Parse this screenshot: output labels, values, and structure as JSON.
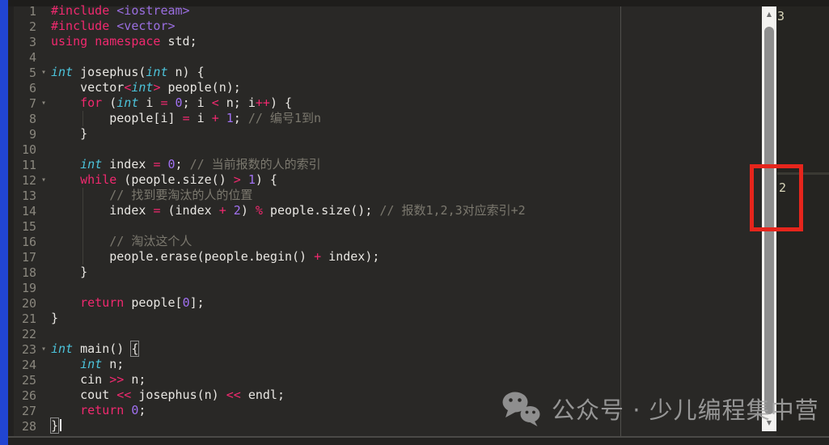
{
  "colors": {
    "bg": "#292826",
    "top-bar": "#1e1d1b",
    "blue": "#2145d2",
    "dark-strip": "#222120",
    "gutter-fg": "#8a877e",
    "kw": "#f1296f",
    "type": "#4cc3da",
    "num": "#a171f2",
    "inc": "#9a6ee0",
    "com": "#7b786e",
    "plain": "#e8e6e2",
    "guide": "#413f3a",
    "ruler": "#51504c",
    "track": "#f3f2f0",
    "thumb": "#8e8e8e",
    "arrow": "#6f6f6f",
    "red": "#e6251c",
    "ann": "#d9d6ba",
    "wm": "#a6a6a6",
    "bracket-box": "#8f8f8f",
    "caret": "#ececec",
    "bottom-line": "#4b4a47",
    "bottom-strip": "#232220",
    "right-panel": "#252421",
    "faint-line": "#3a3933"
  },
  "editor": {
    "language": "cpp",
    "fold_glyph": "▾",
    "lines": [
      {
        "num": "1",
        "fold": false,
        "tokens": [
          [
            "k",
            "#include"
          ],
          [
            "p",
            " "
          ],
          [
            "s",
            "<iostream>"
          ]
        ]
      },
      {
        "num": "2",
        "fold": false,
        "tokens": [
          [
            "k",
            "#include"
          ],
          [
            "p",
            " "
          ],
          [
            "s",
            "<vector>"
          ]
        ]
      },
      {
        "num": "3",
        "fold": false,
        "tokens": [
          [
            "k",
            "using"
          ],
          [
            "p",
            " "
          ],
          [
            "k",
            "namespace"
          ],
          [
            "p",
            " std;"
          ]
        ]
      },
      {
        "num": "4",
        "fold": false,
        "tokens": []
      },
      {
        "num": "5",
        "fold": true,
        "tokens": [
          [
            "t",
            "int"
          ],
          [
            "p",
            " josephus("
          ],
          [
            "t",
            "int"
          ],
          [
            "p",
            " n) {"
          ]
        ]
      },
      {
        "num": "6",
        "fold": false,
        "tokens": [
          [
            "p",
            "    vector"
          ],
          [
            "k",
            "<"
          ],
          [
            "t",
            "int"
          ],
          [
            "k",
            ">"
          ],
          [
            "p",
            " people(n);"
          ]
        ]
      },
      {
        "num": "7",
        "fold": true,
        "tokens": [
          [
            "p",
            "    "
          ],
          [
            "k",
            "for"
          ],
          [
            "p",
            " ("
          ],
          [
            "t",
            "int"
          ],
          [
            "p",
            " i "
          ],
          [
            "k",
            "="
          ],
          [
            "p",
            " "
          ],
          [
            "n",
            "0"
          ],
          [
            "p",
            "; i "
          ],
          [
            "k",
            "<"
          ],
          [
            "p",
            " n; i"
          ],
          [
            "k",
            "++"
          ],
          [
            "p",
            ") {"
          ]
        ]
      },
      {
        "num": "8",
        "fold": false,
        "tokens": [
          [
            "p",
            "        people[i] "
          ],
          [
            "k",
            "="
          ],
          [
            "p",
            " i "
          ],
          [
            "k",
            "+"
          ],
          [
            "p",
            " "
          ],
          [
            "n",
            "1"
          ],
          [
            "p",
            "; "
          ],
          [
            "c",
            "// 编号1到n"
          ]
        ]
      },
      {
        "num": "9",
        "fold": false,
        "tokens": [
          [
            "p",
            "    }"
          ]
        ]
      },
      {
        "num": "10",
        "fold": false,
        "tokens": []
      },
      {
        "num": "11",
        "fold": false,
        "tokens": [
          [
            "p",
            "    "
          ],
          [
            "t",
            "int"
          ],
          [
            "p",
            " index "
          ],
          [
            "k",
            "="
          ],
          [
            "p",
            " "
          ],
          [
            "n",
            "0"
          ],
          [
            "p",
            "; "
          ],
          [
            "c",
            "// 当前报数的人的索引"
          ]
        ]
      },
      {
        "num": "12",
        "fold": true,
        "tokens": [
          [
            "p",
            "    "
          ],
          [
            "k",
            "while"
          ],
          [
            "p",
            " (people.size() "
          ],
          [
            "k",
            ">"
          ],
          [
            "p",
            " "
          ],
          [
            "n",
            "1"
          ],
          [
            "p",
            ") {"
          ]
        ]
      },
      {
        "num": "13",
        "fold": false,
        "tokens": [
          [
            "p",
            "        "
          ],
          [
            "c",
            "// 找到要淘汰的人的位置"
          ]
        ]
      },
      {
        "num": "14",
        "fold": false,
        "tokens": [
          [
            "p",
            "        index "
          ],
          [
            "k",
            "="
          ],
          [
            "p",
            " (index "
          ],
          [
            "k",
            "+"
          ],
          [
            "p",
            " "
          ],
          [
            "n",
            "2"
          ],
          [
            "p",
            ") "
          ],
          [
            "k",
            "%"
          ],
          [
            "p",
            " people.size(); "
          ],
          [
            "c",
            "// 报数1,2,3对应索引+2"
          ]
        ]
      },
      {
        "num": "15",
        "fold": false,
        "tokens": []
      },
      {
        "num": "16",
        "fold": false,
        "tokens": [
          [
            "p",
            "        "
          ],
          [
            "c",
            "// 淘汰这个人"
          ]
        ]
      },
      {
        "num": "17",
        "fold": false,
        "tokens": [
          [
            "p",
            "        people.erase(people.begin() "
          ],
          [
            "k",
            "+"
          ],
          [
            "p",
            " index);"
          ]
        ]
      },
      {
        "num": "18",
        "fold": false,
        "tokens": [
          [
            "p",
            "    }"
          ]
        ]
      },
      {
        "num": "19",
        "fold": false,
        "tokens": []
      },
      {
        "num": "20",
        "fold": false,
        "tokens": [
          [
            "p",
            "    "
          ],
          [
            "k",
            "return"
          ],
          [
            "p",
            " people["
          ],
          [
            "n",
            "0"
          ],
          [
            "p",
            "];"
          ]
        ]
      },
      {
        "num": "21",
        "fold": false,
        "tokens": [
          [
            "p",
            "}"
          ]
        ]
      },
      {
        "num": "22",
        "fold": false,
        "tokens": []
      },
      {
        "num": "23",
        "fold": true,
        "tokens": [
          [
            "t",
            "int"
          ],
          [
            "p",
            " main() "
          ],
          [
            "b",
            "{"
          ]
        ]
      },
      {
        "num": "24",
        "fold": false,
        "tokens": [
          [
            "p",
            "    "
          ],
          [
            "t",
            "int"
          ],
          [
            "p",
            " n;"
          ]
        ]
      },
      {
        "num": "25",
        "fold": false,
        "tokens": [
          [
            "p",
            "    cin "
          ],
          [
            "k",
            ">>"
          ],
          [
            "p",
            " n;"
          ]
        ]
      },
      {
        "num": "26",
        "fold": false,
        "tokens": [
          [
            "p",
            "    cout "
          ],
          [
            "k",
            "<<"
          ],
          [
            "p",
            " josephus(n) "
          ],
          [
            "k",
            "<<"
          ],
          [
            "p",
            " endl;"
          ]
        ]
      },
      {
        "num": "27",
        "fold": false,
        "tokens": [
          [
            "p",
            "    "
          ],
          [
            "k",
            "return"
          ],
          [
            "p",
            " "
          ],
          [
            "n",
            "0"
          ],
          [
            "p",
            ";"
          ]
        ]
      },
      {
        "num": "28",
        "fold": false,
        "tokens": [
          [
            "b",
            "}"
          ],
          [
            "caret",
            ""
          ]
        ]
      }
    ]
  },
  "scrollbar": {
    "up_arrow": "▲",
    "down_arrow": "▼"
  },
  "annotations": {
    "top_right_number": "3",
    "boxed_number": "2"
  },
  "watermark": {
    "icon": "wechat-icon",
    "text": "公众号 · 少儿编程集中营"
  }
}
